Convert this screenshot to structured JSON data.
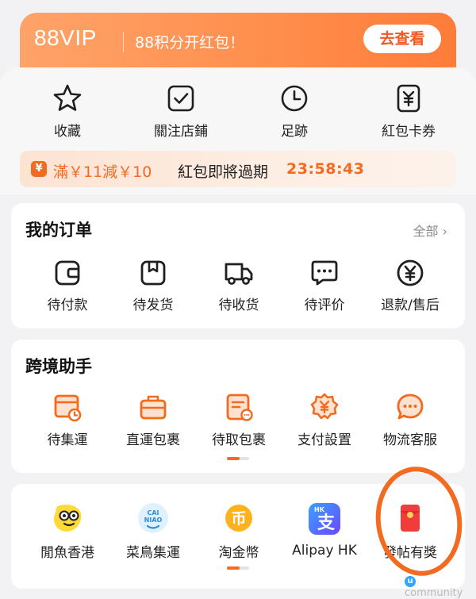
{
  "vip_banner": {
    "logo": "88VIP",
    "promo": "88积分开红包！",
    "button": "去查看"
  },
  "quick_actions": [
    {
      "label": "收藏",
      "icon": "star-icon"
    },
    {
      "label": "關注店鋪",
      "icon": "checkbox-icon"
    },
    {
      "label": "足跡",
      "icon": "clock-icon"
    },
    {
      "label": "紅包卡券",
      "icon": "coupon-icon"
    }
  ],
  "expiry_notice": {
    "amount": "滿￥11減￥10",
    "text": "紅包即將過期",
    "countdown": "23:58:43"
  },
  "orders": {
    "title": "我的订单",
    "view_all": "全部",
    "items": [
      {
        "label": "待付款",
        "icon": "wallet-icon"
      },
      {
        "label": "待发货",
        "icon": "package-icon"
      },
      {
        "label": "待收货",
        "icon": "truck-icon"
      },
      {
        "label": "待评价",
        "icon": "chat-icon"
      },
      {
        "label": "退款/售后",
        "icon": "yen-icon"
      }
    ]
  },
  "cross_border": {
    "title": "跨境助手",
    "items": [
      {
        "label": "待集運",
        "icon": "box-clock-icon"
      },
      {
        "label": "直運包裹",
        "icon": "briefcase-icon"
      },
      {
        "label": "待取包裹",
        "icon": "receipt-icon"
      },
      {
        "label": "支付設置",
        "icon": "yen-gear-icon"
      },
      {
        "label": "物流客服",
        "icon": "chat-bubble-icon"
      }
    ],
    "page_indicator": {
      "current": 1,
      "total": 2
    }
  },
  "apps": {
    "items": [
      {
        "label": "閒魚香港",
        "icon": "xianyu-icon"
      },
      {
        "label": "菜鳥集運",
        "icon": "cainiao-icon",
        "logo_text": "CAI\nNIAO"
      },
      {
        "label": "淘金幣",
        "icon": "coin-icon",
        "logo_text": "币"
      },
      {
        "label": "Alipay HK",
        "icon": "alipay-icon",
        "logo_text": "支",
        "badge": "HK"
      },
      {
        "label": "發帖有獎",
        "icon": "red-envelope-icon"
      }
    ],
    "page_indicator": {
      "current": 1,
      "total": 2
    }
  },
  "watermark": "community",
  "colors": {
    "accent": "#f26b21",
    "vip_gradient_start": "#ffa36a",
    "vip_gradient_end": "#ff7c3a",
    "background": "#f2f2f4"
  }
}
